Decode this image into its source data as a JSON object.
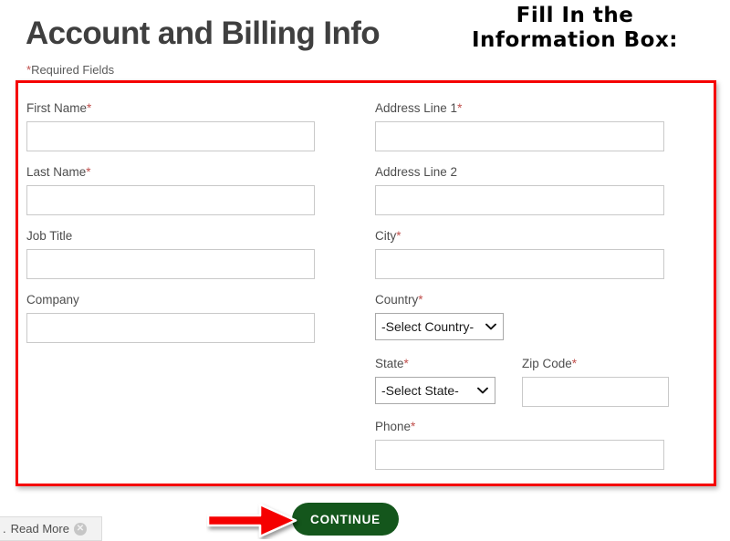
{
  "header": {
    "title": "Account and Billing Info",
    "required_note_star": "*",
    "required_note_text": "Required Fields"
  },
  "annotation": {
    "line1": "Fill In the",
    "line2": "Information Box:",
    "arrow_icon": "right-arrow-icon",
    "arrow_color": "#f50000",
    "box_border_color": "#f50000"
  },
  "form": {
    "left_column": [
      {
        "label": "First Name",
        "required": "*",
        "value": "",
        "placeholder": "",
        "type": "text"
      },
      {
        "label": "Last Name",
        "required": "*",
        "value": "",
        "placeholder": "",
        "type": "text"
      },
      {
        "label": "Job Title",
        "required": "",
        "value": "",
        "placeholder": "",
        "type": "text"
      },
      {
        "label": "Company",
        "required": "",
        "value": "",
        "placeholder": "",
        "type": "text"
      }
    ],
    "right_column": [
      {
        "label": "Address Line 1",
        "required": "*",
        "value": "",
        "placeholder": "",
        "type": "text"
      },
      {
        "label": "Address Line 2",
        "required": "",
        "value": "",
        "placeholder": "",
        "type": "text"
      },
      {
        "label": "City",
        "required": "*",
        "value": "",
        "placeholder": "",
        "type": "text"
      }
    ],
    "country": {
      "label": "Country",
      "required": "*",
      "selected": "-Select Country-",
      "options": [
        "-Select Country-"
      ]
    },
    "state": {
      "label": "State",
      "required": "*",
      "selected": "-Select State-",
      "options": [
        "-Select State-"
      ]
    },
    "zip": {
      "label": "Zip Code",
      "required": "*",
      "value": "",
      "placeholder": ""
    },
    "phone": {
      "label": "Phone",
      "required": "*",
      "value": "",
      "placeholder": ""
    }
  },
  "actions": {
    "continue_label": "CONTINUE",
    "continue_color": "#14561c"
  },
  "read_more_widget": {
    "leading_text": ".",
    "label": "Read More",
    "close_icon": "close-icon"
  }
}
